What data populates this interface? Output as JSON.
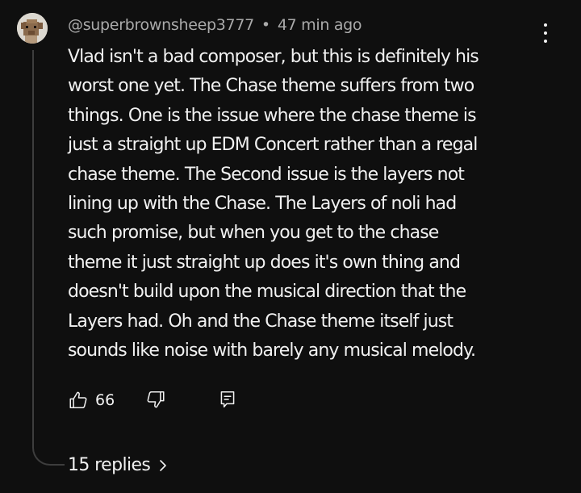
{
  "comment": {
    "author": "@superbrownsheep3777",
    "separator": "•",
    "timestamp": "47 min ago",
    "lines": [
      "Vlad isn't a bad composer, but this is definitely his",
      "worst one yet. The Chase theme suffers from two",
      "things. One is the issue where the chase theme is",
      "just a straight up EDM Concert rather than a regal",
      "chase theme. The Second issue is the layers not",
      "lining up with the Chase. The Layers of noli had",
      "such promise, but when you get to the chase",
      "theme it just straight up does it's own thing and",
      "doesn't build upon the musical direction that the",
      "Layers had. Oh and the Chase theme itself just",
      "sounds like noise with barely any musical melody."
    ]
  },
  "actions": {
    "like_icon": "thumbs-up-icon",
    "like_count": "66",
    "dislike_icon": "thumbs-down-icon",
    "reply_icon": "reply-comment-icon"
  },
  "replies": {
    "label": "15 replies",
    "icon": "chevron-right-icon"
  },
  "menu": {
    "icon": "more-vertical-icon"
  },
  "colors": {
    "background": "#0f0f0f",
    "text_primary": "#f1f1f1",
    "text_secondary": "#aaaaaa",
    "thread_line": "#3d3d3d"
  }
}
